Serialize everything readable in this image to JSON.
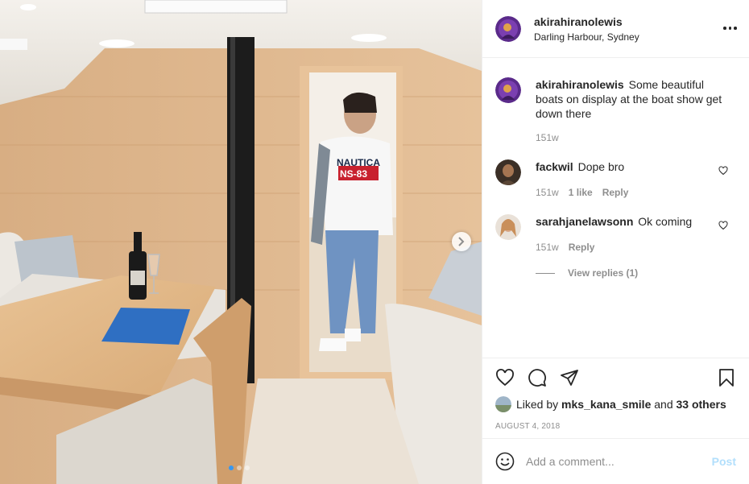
{
  "post": {
    "author": {
      "username": "akirahiranolewis",
      "location": "Darling Harbour, Sydney",
      "avatar_icon": "avatar-icon"
    },
    "caption": {
      "username": "akirahiranolewis",
      "text": "Some beautiful boats on display at the boat show get down there",
      "time": "151w"
    },
    "comments": [
      {
        "username": "fackwil",
        "text": "Dope bro",
        "time": "151w",
        "likes": "1 like",
        "reply_label": "Reply"
      },
      {
        "username": "sarahjanelawsonn",
        "text": "Ok coming",
        "time": "151w",
        "likes": "",
        "reply_label": "Reply",
        "view_replies": "View replies (1)"
      }
    ],
    "likes": {
      "prefix": "Liked by",
      "user": "mks_kana_smile",
      "joiner": "and",
      "others": "33 others"
    },
    "date": "AUGUST 4, 2018",
    "add_comment": {
      "placeholder": "Add a comment...",
      "post_label": "Post"
    },
    "carousel": {
      "count": 3,
      "active": 1
    },
    "photo": {
      "tshirt_text_top": "NAUTICA",
      "tshirt_text_bottom": "NS-83"
    },
    "colors": {
      "accent": "#3897f0",
      "post_disabled": "#b2dffc",
      "muted": "#8e8e8e",
      "text": "#262626",
      "border": "#efefef"
    }
  }
}
